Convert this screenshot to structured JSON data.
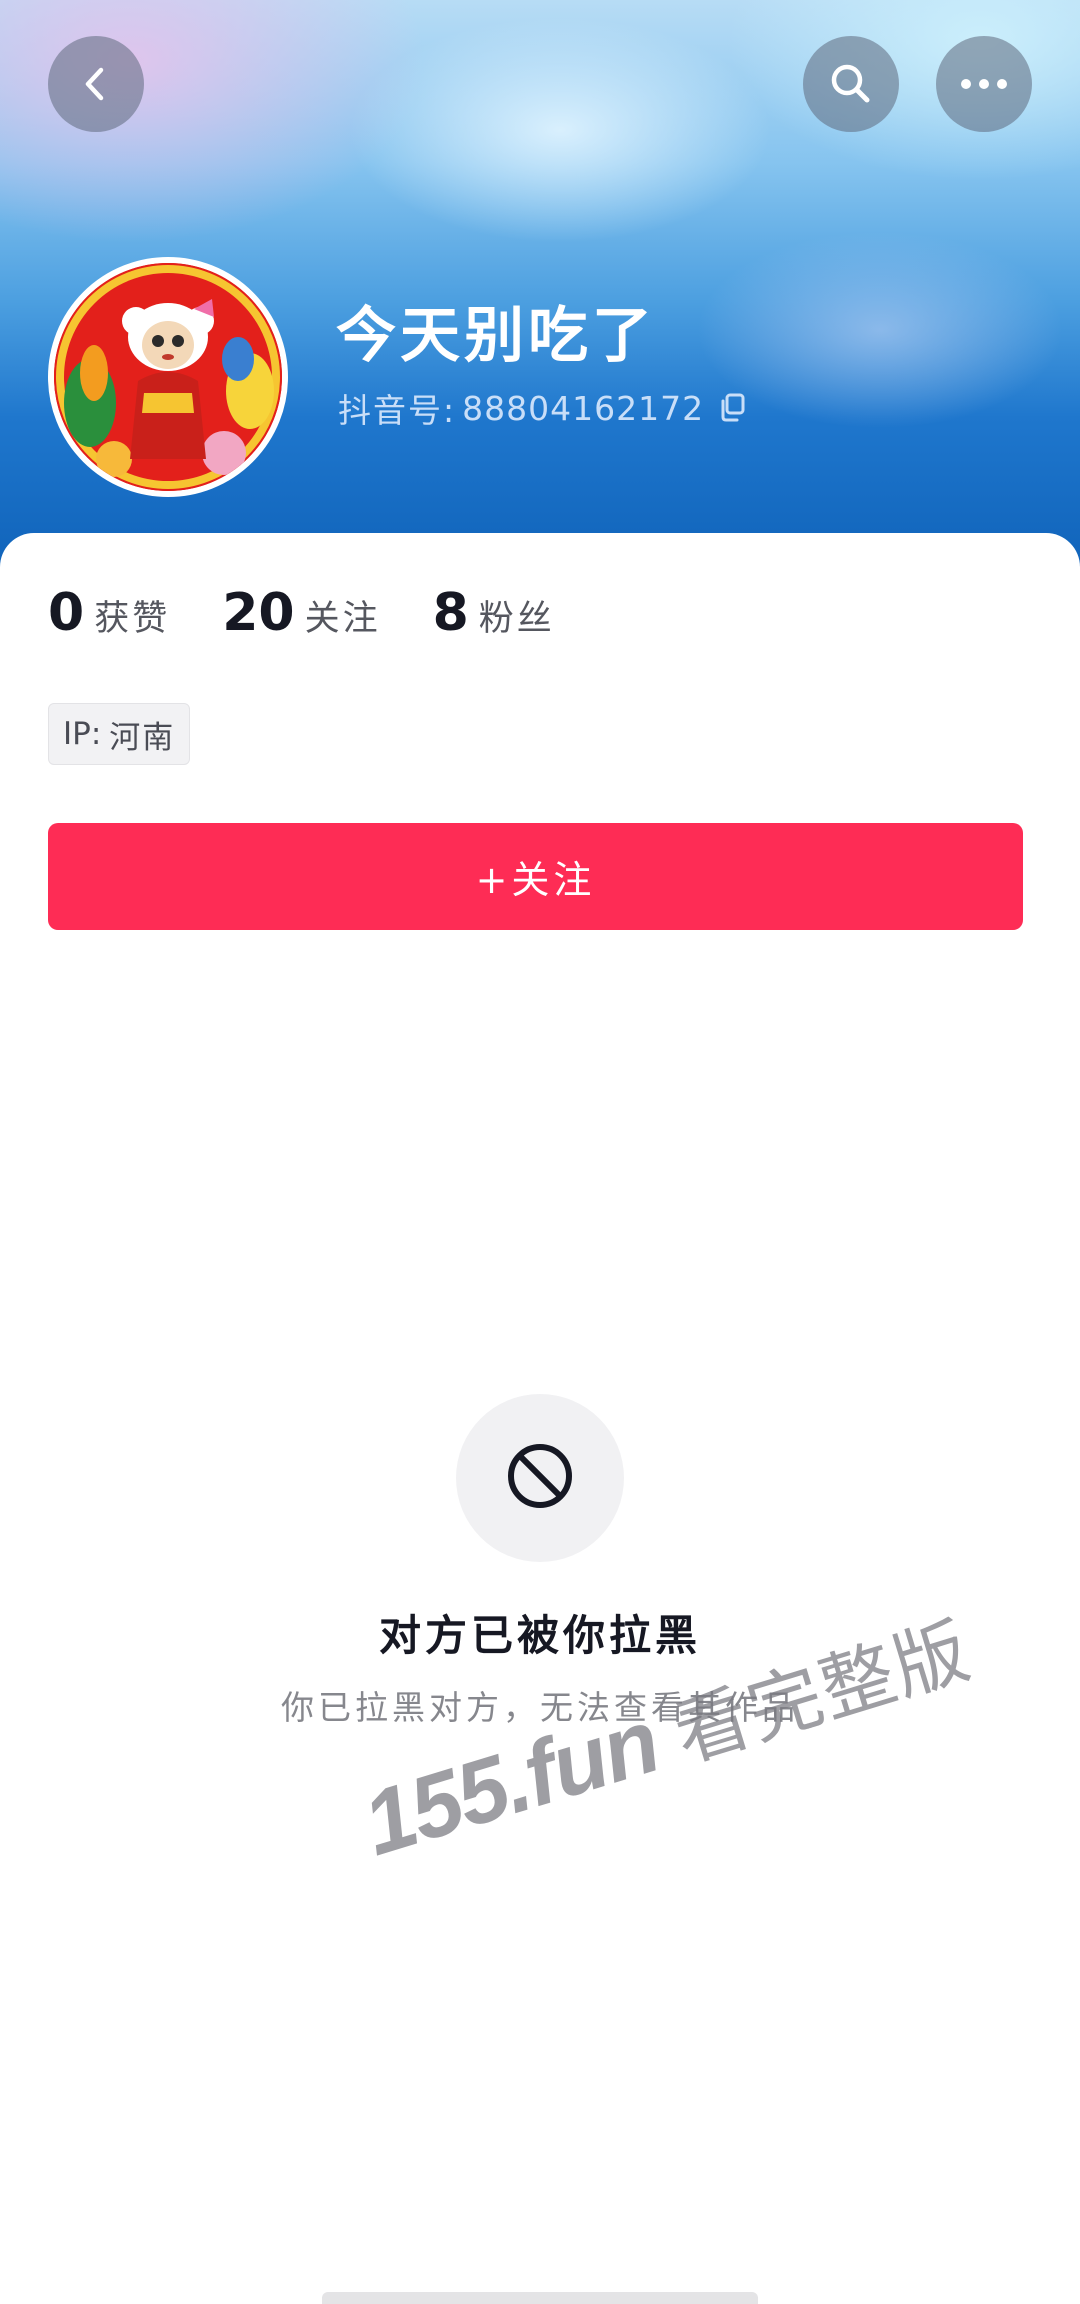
{
  "profile": {
    "nickname": "今天别吃了",
    "account_label": "抖音号:",
    "account_id": "88804162172",
    "avatar_icon": "avatar-image"
  },
  "nav": {
    "back_icon": "chevron-left-icon",
    "search_icon": "search-icon",
    "more_icon": "more-horizontal-icon"
  },
  "stats": [
    {
      "value": "0",
      "label": "获赞"
    },
    {
      "value": "20",
      "label": "关注"
    },
    {
      "value": "8",
      "label": "粉丝"
    }
  ],
  "ip": {
    "label": "IP:",
    "value": "河南"
  },
  "follow_button": {
    "label": "+关注",
    "color": "#fe2c55"
  },
  "blocked": {
    "icon": "block-icon",
    "title": "对方已被你拉黑",
    "description": "你已拉黑对方，无法查看其作品"
  },
  "watermark": {
    "domain": "155.fun",
    "text": "看完整版"
  }
}
